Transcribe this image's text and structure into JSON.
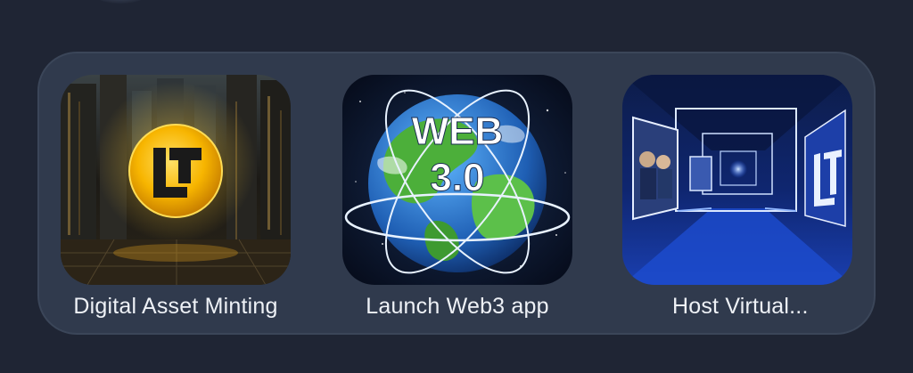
{
  "apps": [
    {
      "label": "Digital Asset Minting",
      "icon": "lt-logo-coin-icon",
      "accent": "#f5b400"
    },
    {
      "label": "Launch Web3 app",
      "icon": "web3-globe-icon",
      "thumb_text_line1": "WEB",
      "thumb_text_line2": "3.0",
      "accent": "#4fa3e8"
    },
    {
      "label": "Host Virtual...",
      "icon": "virtual-gallery-icon",
      "accent": "#2f6cff"
    }
  ],
  "colors": {
    "background": "#1f2534",
    "panel": "#303a4d",
    "label_text": "#eef1f6"
  }
}
